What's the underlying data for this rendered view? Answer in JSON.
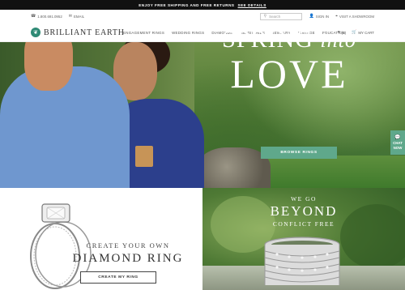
{
  "promo_bar": {
    "text": "ENJOY FREE SHIPPING AND FREE RETURNS",
    "link": "SEE DETAILS"
  },
  "utility": {
    "phone": "1.800.691.0952",
    "email": "EMAIL",
    "search_placeholder": "Search",
    "sign_in": "SIGN IN",
    "showroom": "VISIT A SHOWROOM"
  },
  "nav": {
    "logo": "BRILLIANT EARTH",
    "links": [
      "ENGAGEMENT RINGS",
      "WEDDING RINGS",
      "DIAMONDS",
      "GEMSTONES",
      "JEWELRY",
      "VINTAGE",
      "EDUCATION"
    ],
    "wishlist": "(0)",
    "cart": "MY CART"
  },
  "hero": {
    "line1a": "SPRING",
    "line1b": "into",
    "line2": "LOVE",
    "button": "BROWSE RINGS"
  },
  "chat": {
    "line1": "CHAT",
    "line2": "NOW"
  },
  "promo_left": {
    "small": "CREATE YOUR OWN",
    "big": "DIAMOND RING",
    "button": "CREATE MY RING"
  },
  "promo_right": {
    "small": "WE GO",
    "big": "BEYOND",
    "sub": "CONFLICT FREE"
  },
  "colors": {
    "accent": "#5fa88b",
    "logo": "#2f8a75",
    "promo_bar": "#111111"
  }
}
